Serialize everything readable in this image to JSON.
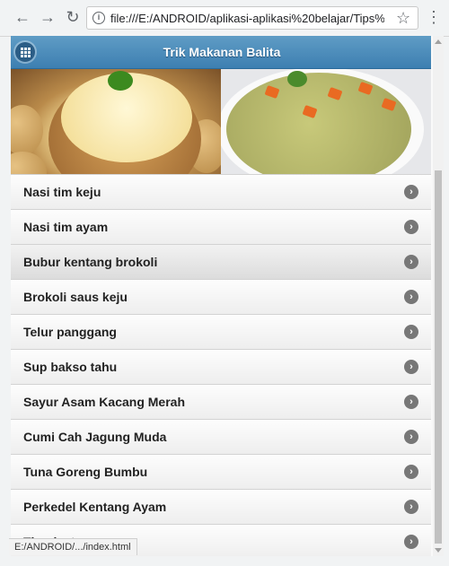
{
  "browser": {
    "url": "file:///E:/ANDROID/aplikasi-aplikasi%20belajar/Tips%20",
    "status_url": "E:/ANDROID/.../index.html"
  },
  "header": {
    "title": "Trik Makanan Balita"
  },
  "items": [
    {
      "label": "Nasi tim keju"
    },
    {
      "label": "Nasi tim ayam"
    },
    {
      "label": "Bubur kentang brokoli"
    },
    {
      "label": "Brokoli saus keju"
    },
    {
      "label": "Telur panggang"
    },
    {
      "label": "Sup bakso tahu"
    },
    {
      "label": "Sayur Asam Kacang Merah"
    },
    {
      "label": "Cumi Cah Jagung Muda"
    },
    {
      "label": "Tuna Goreng Bumbu"
    },
    {
      "label": "Perkedel Kentang Ayam"
    },
    {
      "label": "Thanks to"
    }
  ],
  "colors": {
    "header": "#3d7fb1",
    "text": "#222222"
  }
}
